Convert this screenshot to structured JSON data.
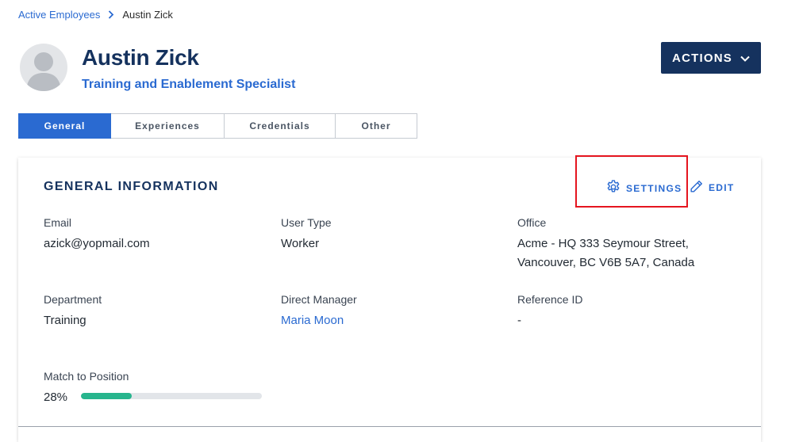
{
  "breadcrumb": {
    "parent": "Active Employees",
    "current": "Austin Zick"
  },
  "profile": {
    "name": "Austin Zick",
    "title": "Training and Enablement Specialist",
    "actions_label": "ACTIONS"
  },
  "tabs": [
    {
      "label": "General",
      "active": true
    },
    {
      "label": "Experiences",
      "active": false
    },
    {
      "label": "Credentials",
      "active": false
    },
    {
      "label": "Other",
      "active": false
    }
  ],
  "general": {
    "heading": "GENERAL INFORMATION",
    "settings_label": "SETTINGS",
    "edit_label": "EDIT",
    "email": {
      "label": "Email",
      "value": "azick@yopmail.com"
    },
    "user_type": {
      "label": "User Type",
      "value": "Worker"
    },
    "office": {
      "label": "Office",
      "line1": "Acme - HQ 333 Seymour Street,",
      "line2": "Vancouver, BC V6B 5A7, Canada"
    },
    "department": {
      "label": "Department",
      "value": "Training"
    },
    "direct_manager": {
      "label": "Direct Manager",
      "value": "Maria Moon"
    },
    "reference_id": {
      "label": "Reference ID",
      "value": "-"
    },
    "match": {
      "label": "Match to Position",
      "value_text": "28%",
      "percent": 28
    }
  },
  "colors": {
    "brand_navy": "#15325e",
    "link_blue": "#2a6ad1",
    "progress_green": "#27b58d",
    "highlight_red": "#e5151f"
  },
  "icons": {
    "breadcrumb_separator": "chevron-right-icon",
    "actions_caret": "chevron-down-icon",
    "settings": "gear-icon",
    "edit": "pencil-icon",
    "avatar": "user-silhouette-icon"
  }
}
